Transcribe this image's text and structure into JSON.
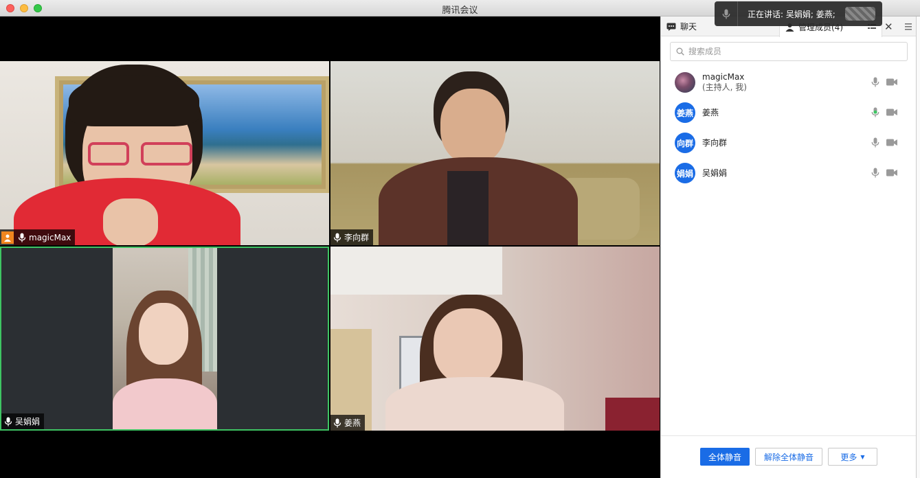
{
  "window": {
    "title": "腾讯会议"
  },
  "toast": {
    "text": "正在讲话: 吴娟娟; 姜燕;"
  },
  "videos": [
    {
      "name": "magicMax",
      "host": true
    },
    {
      "name": "李向群"
    },
    {
      "name": "吴娟娟",
      "active_speaker": true
    },
    {
      "name": "姜燕"
    }
  ],
  "panel": {
    "tabs": {
      "chat": "聊天",
      "members": "管理成员(4)"
    },
    "search_placeholder": "搜索成员",
    "members": [
      {
        "avatar": "",
        "name": "magicMax",
        "sub": "(主持人, 我)",
        "mic_active": false
      },
      {
        "avatar": "姜燕",
        "name": "姜燕",
        "mic_active": true
      },
      {
        "avatar": "向群",
        "name": "李向群",
        "mic_active": false
      },
      {
        "avatar": "娟娟",
        "name": "吴娟娟",
        "mic_active": false
      }
    ],
    "buttons": {
      "mute_all": "全体静音",
      "unmute_all": "解除全体静音",
      "more": "更多"
    }
  },
  "colors": {
    "accent": "#1a6ce6",
    "host_badge": "#f0851f",
    "speaker_border": "#3ec463",
    "mic_active": "#3ec463"
  }
}
